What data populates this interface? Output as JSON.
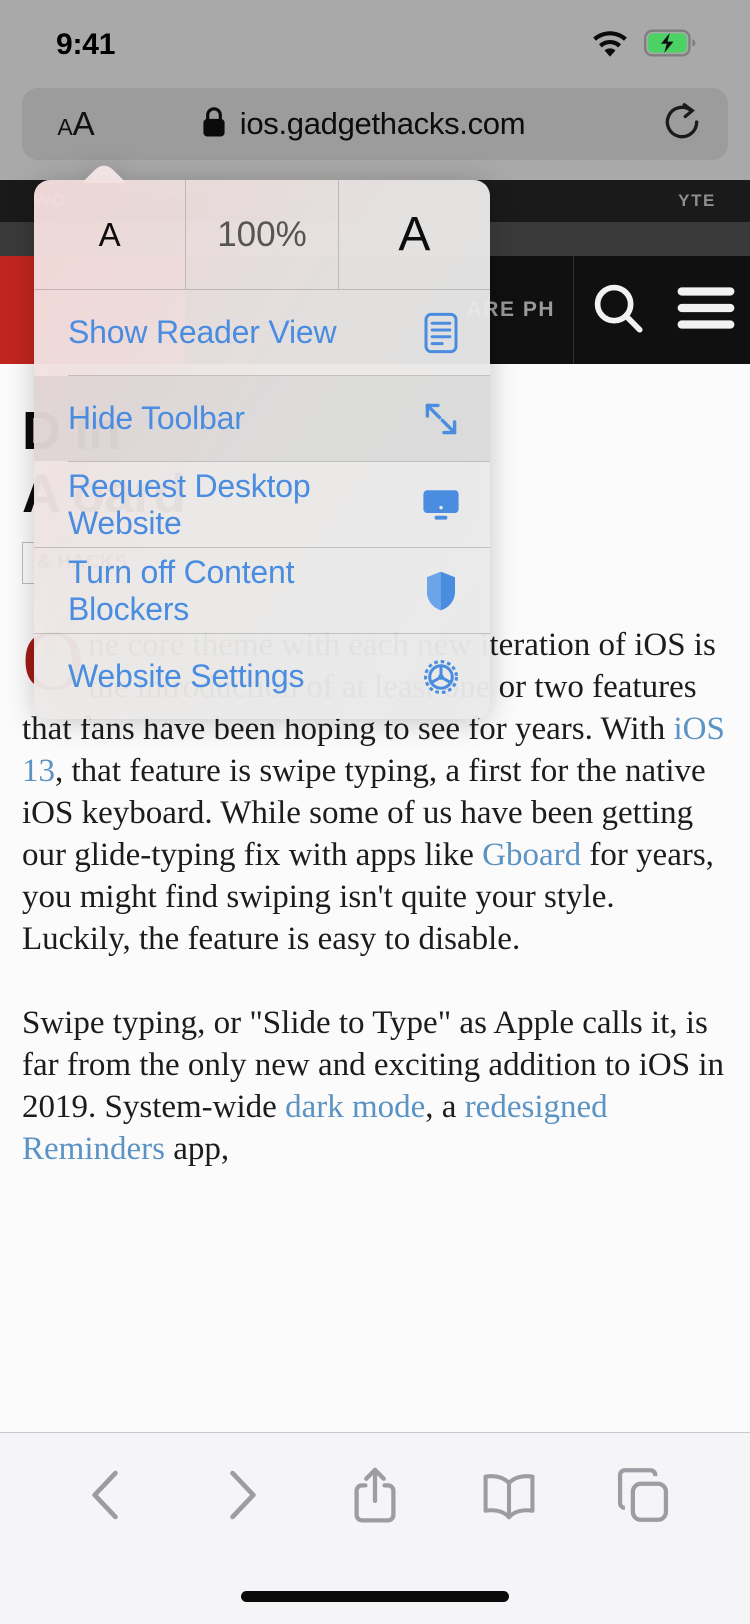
{
  "status_bar": {
    "time": "9:41",
    "wifi_icon": "wifi-icon",
    "battery_icon": "battery-charging-icon"
  },
  "url_bar": {
    "aa_small": "A",
    "aa_large": "A",
    "lock_icon": "lock-icon",
    "url": "ios.gadgethacks.com",
    "reload_icon": "reload-icon"
  },
  "popover": {
    "zoom": {
      "decrease_label": "A",
      "percent": "100%",
      "increase_label": "A"
    },
    "items": [
      {
        "label": "Show Reader View",
        "icon": "reader-view-icon",
        "pressed": false
      },
      {
        "label": "Hide Toolbar",
        "icon": "expand-arrows-icon",
        "pressed": true
      },
      {
        "label": "Request Desktop Website",
        "icon": "desktop-monitor-icon",
        "pressed": false
      },
      {
        "label": "Turn off Content Blockers",
        "icon": "shield-icon",
        "pressed": false
      },
      {
        "label": "Website Settings",
        "icon": "gear-icon",
        "pressed": false
      }
    ]
  },
  "webpage": {
    "topstrip_left": "WO",
    "topstrip_right": "YTE",
    "nav_text": "ARE PH",
    "search_icon": "search-icon",
    "menu_icon": "hamburger-menu-icon",
    "headline_line1": "D                              in",
    "headline_line2": "A                        oard",
    "tag": "& HACKS",
    "paragraph1_dropcap": "O",
    "paragraph1": {
      "part1": "ne core theme with each new iteration of iOS is the introduction of at least one or two features that fans have been hoping to see for years. With ",
      "link1": "iOS 13",
      "part2": ", that feature is swipe typing, a first for the native iOS keyboard. While some of us have been getting our glide-typing fix with apps like ",
      "link2": "Gboard",
      "part3": " for years, you might find swiping isn't quite your style. Luckily, the feature is easy to disable."
    },
    "paragraph2": {
      "part1": "Swipe typing, or \"Slide to Type\" as Apple calls it, is far from the only new and exciting addition to iOS in 2019. System-wide ",
      "link1": "dark mode",
      "part2": ", a ",
      "link2": "redesigned Reminders",
      "part3": " app,"
    }
  },
  "bottom_bar": {
    "back_icon": "chevron-left-icon",
    "forward_icon": "chevron-right-icon",
    "share_icon": "share-icon",
    "bookmarks_icon": "book-icon",
    "tabs_icon": "tabs-icon"
  },
  "colors": {
    "accent_blue": "#4a8ce0",
    "chrome_gray": "#a9a9a9",
    "brand_red": "#c2251e",
    "dropcap_red": "#a11b16"
  }
}
